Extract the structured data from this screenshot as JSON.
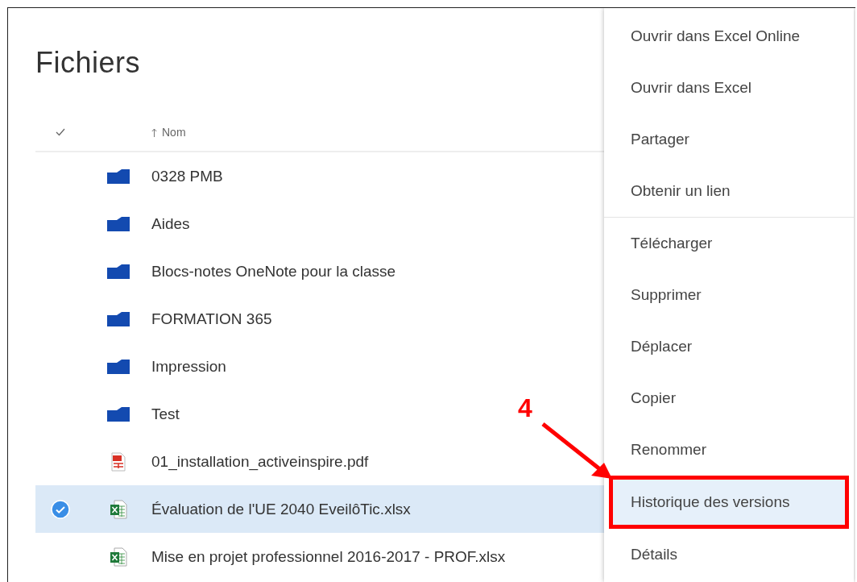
{
  "title": "Fichiers",
  "table": {
    "columns": [
      {
        "label": "Nom",
        "sorted": true
      }
    ],
    "rows": [
      {
        "name": "0328 PMB",
        "kind": "folder",
        "selected": false
      },
      {
        "name": "Aides",
        "kind": "folder",
        "selected": false
      },
      {
        "name": "Blocs-notes OneNote pour la classe",
        "kind": "folder",
        "selected": false
      },
      {
        "name": "FORMATION 365",
        "kind": "folder",
        "selected": false
      },
      {
        "name": "Impression",
        "kind": "folder",
        "selected": false
      },
      {
        "name": "Test",
        "kind": "folder",
        "selected": false
      },
      {
        "name": "01_installation_activeinspire.pdf",
        "kind": "pdf",
        "selected": false
      },
      {
        "name": "Évaluation de l'UE 2040 EveilôTic.xlsx",
        "kind": "excel",
        "selected": true
      },
      {
        "name": "Mise en projet professionnel 2016-2017 - PROF.xlsx",
        "kind": "excel",
        "selected": false
      }
    ]
  },
  "context_menu": {
    "groups": [
      [
        {
          "label": "Ouvrir dans Excel Online",
          "highlighted": false
        },
        {
          "label": "Ouvrir dans Excel",
          "highlighted": false
        },
        {
          "label": "Partager",
          "highlighted": false
        },
        {
          "label": "Obtenir un lien",
          "highlighted": false
        }
      ],
      [
        {
          "label": "Télécharger",
          "highlighted": false
        },
        {
          "label": "Supprimer",
          "highlighted": false
        },
        {
          "label": "Déplacer",
          "highlighted": false
        },
        {
          "label": "Copier",
          "highlighted": false
        },
        {
          "label": "Renommer",
          "highlighted": false
        },
        {
          "label": "Historique des versions",
          "highlighted": true
        },
        {
          "label": "Détails",
          "highlighted": false
        }
      ]
    ]
  },
  "annotation": {
    "label": "4"
  }
}
